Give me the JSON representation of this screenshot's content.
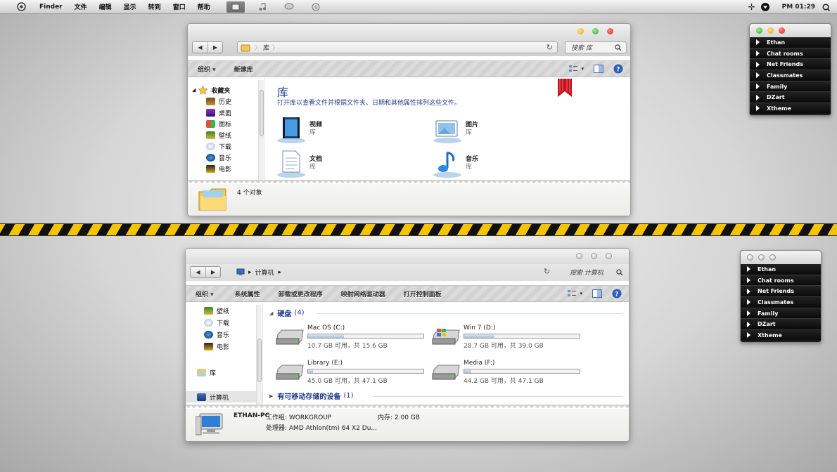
{
  "menubar": {
    "app": "Finder",
    "items": [
      "文件",
      "编辑",
      "显示",
      "转到",
      "窗口",
      "帮助"
    ],
    "clock": "PM 01:29"
  },
  "win1": {
    "breadcrumb": "库",
    "search_placeholder": "搜索 库",
    "toolbar": {
      "organize": "组织",
      "new_library": "新建库"
    },
    "sidebar": {
      "group": "收藏夹",
      "items": [
        "历史",
        "桌面",
        "图标",
        "壁纸",
        "下载",
        "音乐",
        "电影"
      ]
    },
    "main": {
      "title": "库",
      "description": "打开库以查看文件并根据文件夹、日期和其他属性排列这些文件。",
      "libraries": [
        {
          "name": "视频",
          "type": "库"
        },
        {
          "name": "图片",
          "type": "库"
        },
        {
          "name": "文档",
          "type": "库"
        },
        {
          "name": "音乐",
          "type": "库"
        }
      ]
    },
    "status": "4 个对象"
  },
  "win2": {
    "breadcrumb": "计算机",
    "search_placeholder": "搜索 计算机",
    "toolbar": {
      "organize": "组织",
      "system_props": "系统属性",
      "uninstall": "卸载或更改程序",
      "map_drive": "映射网络驱动器",
      "control_panel": "打开控制面板"
    },
    "sidebar": {
      "items": [
        "壁纸",
        "下载",
        "音乐",
        "电影"
      ],
      "library": "库",
      "computer": "计算机"
    },
    "hard_disks": {
      "header": "硬盘",
      "count": "(4)",
      "drives": [
        {
          "name": "Mac OS (C:)",
          "info": "10.7 GB 可用，共 15.6 GB",
          "used_fraction": 0.31
        },
        {
          "name": "Win 7 (D:)",
          "info": "28.7 GB 可用，共 39.0 GB",
          "used_fraction": 0.26
        },
        {
          "name": "Library (E:)",
          "info": "45.0 GB 可用，共 47.1 GB",
          "used_fraction": 0.04
        },
        {
          "name": "Media (F:)",
          "info": "44.2 GB 可用，共 47.1 GB",
          "used_fraction": 0.06
        }
      ]
    },
    "removable": {
      "header": "有可移动存储的设备",
      "count": "(1)"
    },
    "details": {
      "pc_name": "ETHAN-PC",
      "workgroup": "工作组: WORKGROUP",
      "memory": "内存: 2.00 GB",
      "processor": "处理器: AMD Athlon(tm) 64 X2 Du..."
    }
  },
  "widgets": {
    "items": [
      "Ethan",
      "Chat rooms",
      "Net Friends",
      "Classmates",
      "Family",
      "DZart",
      "Xtheme"
    ]
  },
  "colors": {
    "hazard_yellow": "#f5c400",
    "header_blue": "#1e3a8a",
    "close_red": "#e0342e",
    "min_yellow": "#f1b82a",
    "zoom_green": "#3fb34a"
  }
}
